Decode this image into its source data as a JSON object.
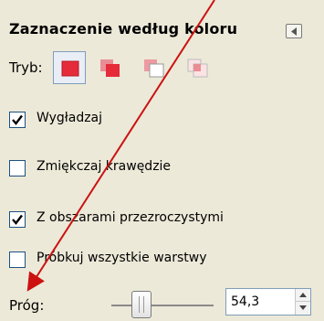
{
  "title": "Zaznaczenie według koloru",
  "mode": {
    "label": "Tryb:",
    "buttons": [
      {
        "name": "replace",
        "icon": "mode-replace-icon",
        "active": true
      },
      {
        "name": "add",
        "icon": "mode-add-icon",
        "active": false
      },
      {
        "name": "subtract",
        "icon": "mode-subtract-icon",
        "active": false
      },
      {
        "name": "intersect",
        "icon": "mode-intersect-icon",
        "active": false
      }
    ]
  },
  "options": [
    {
      "label": "Wygładzaj",
      "checked": true
    },
    {
      "label": "Zmiękczaj krawędzie",
      "checked": false
    },
    {
      "label": "Z obszarami przezroczystymi",
      "checked": true
    },
    {
      "label": "Próbkuj wszystkie warstwy",
      "checked": false
    }
  ],
  "threshold": {
    "label": "Próg:",
    "value": "54,3"
  },
  "colors": {
    "annotation_arrow": "#cc1111",
    "mode_icon": "#e52a3a"
  }
}
